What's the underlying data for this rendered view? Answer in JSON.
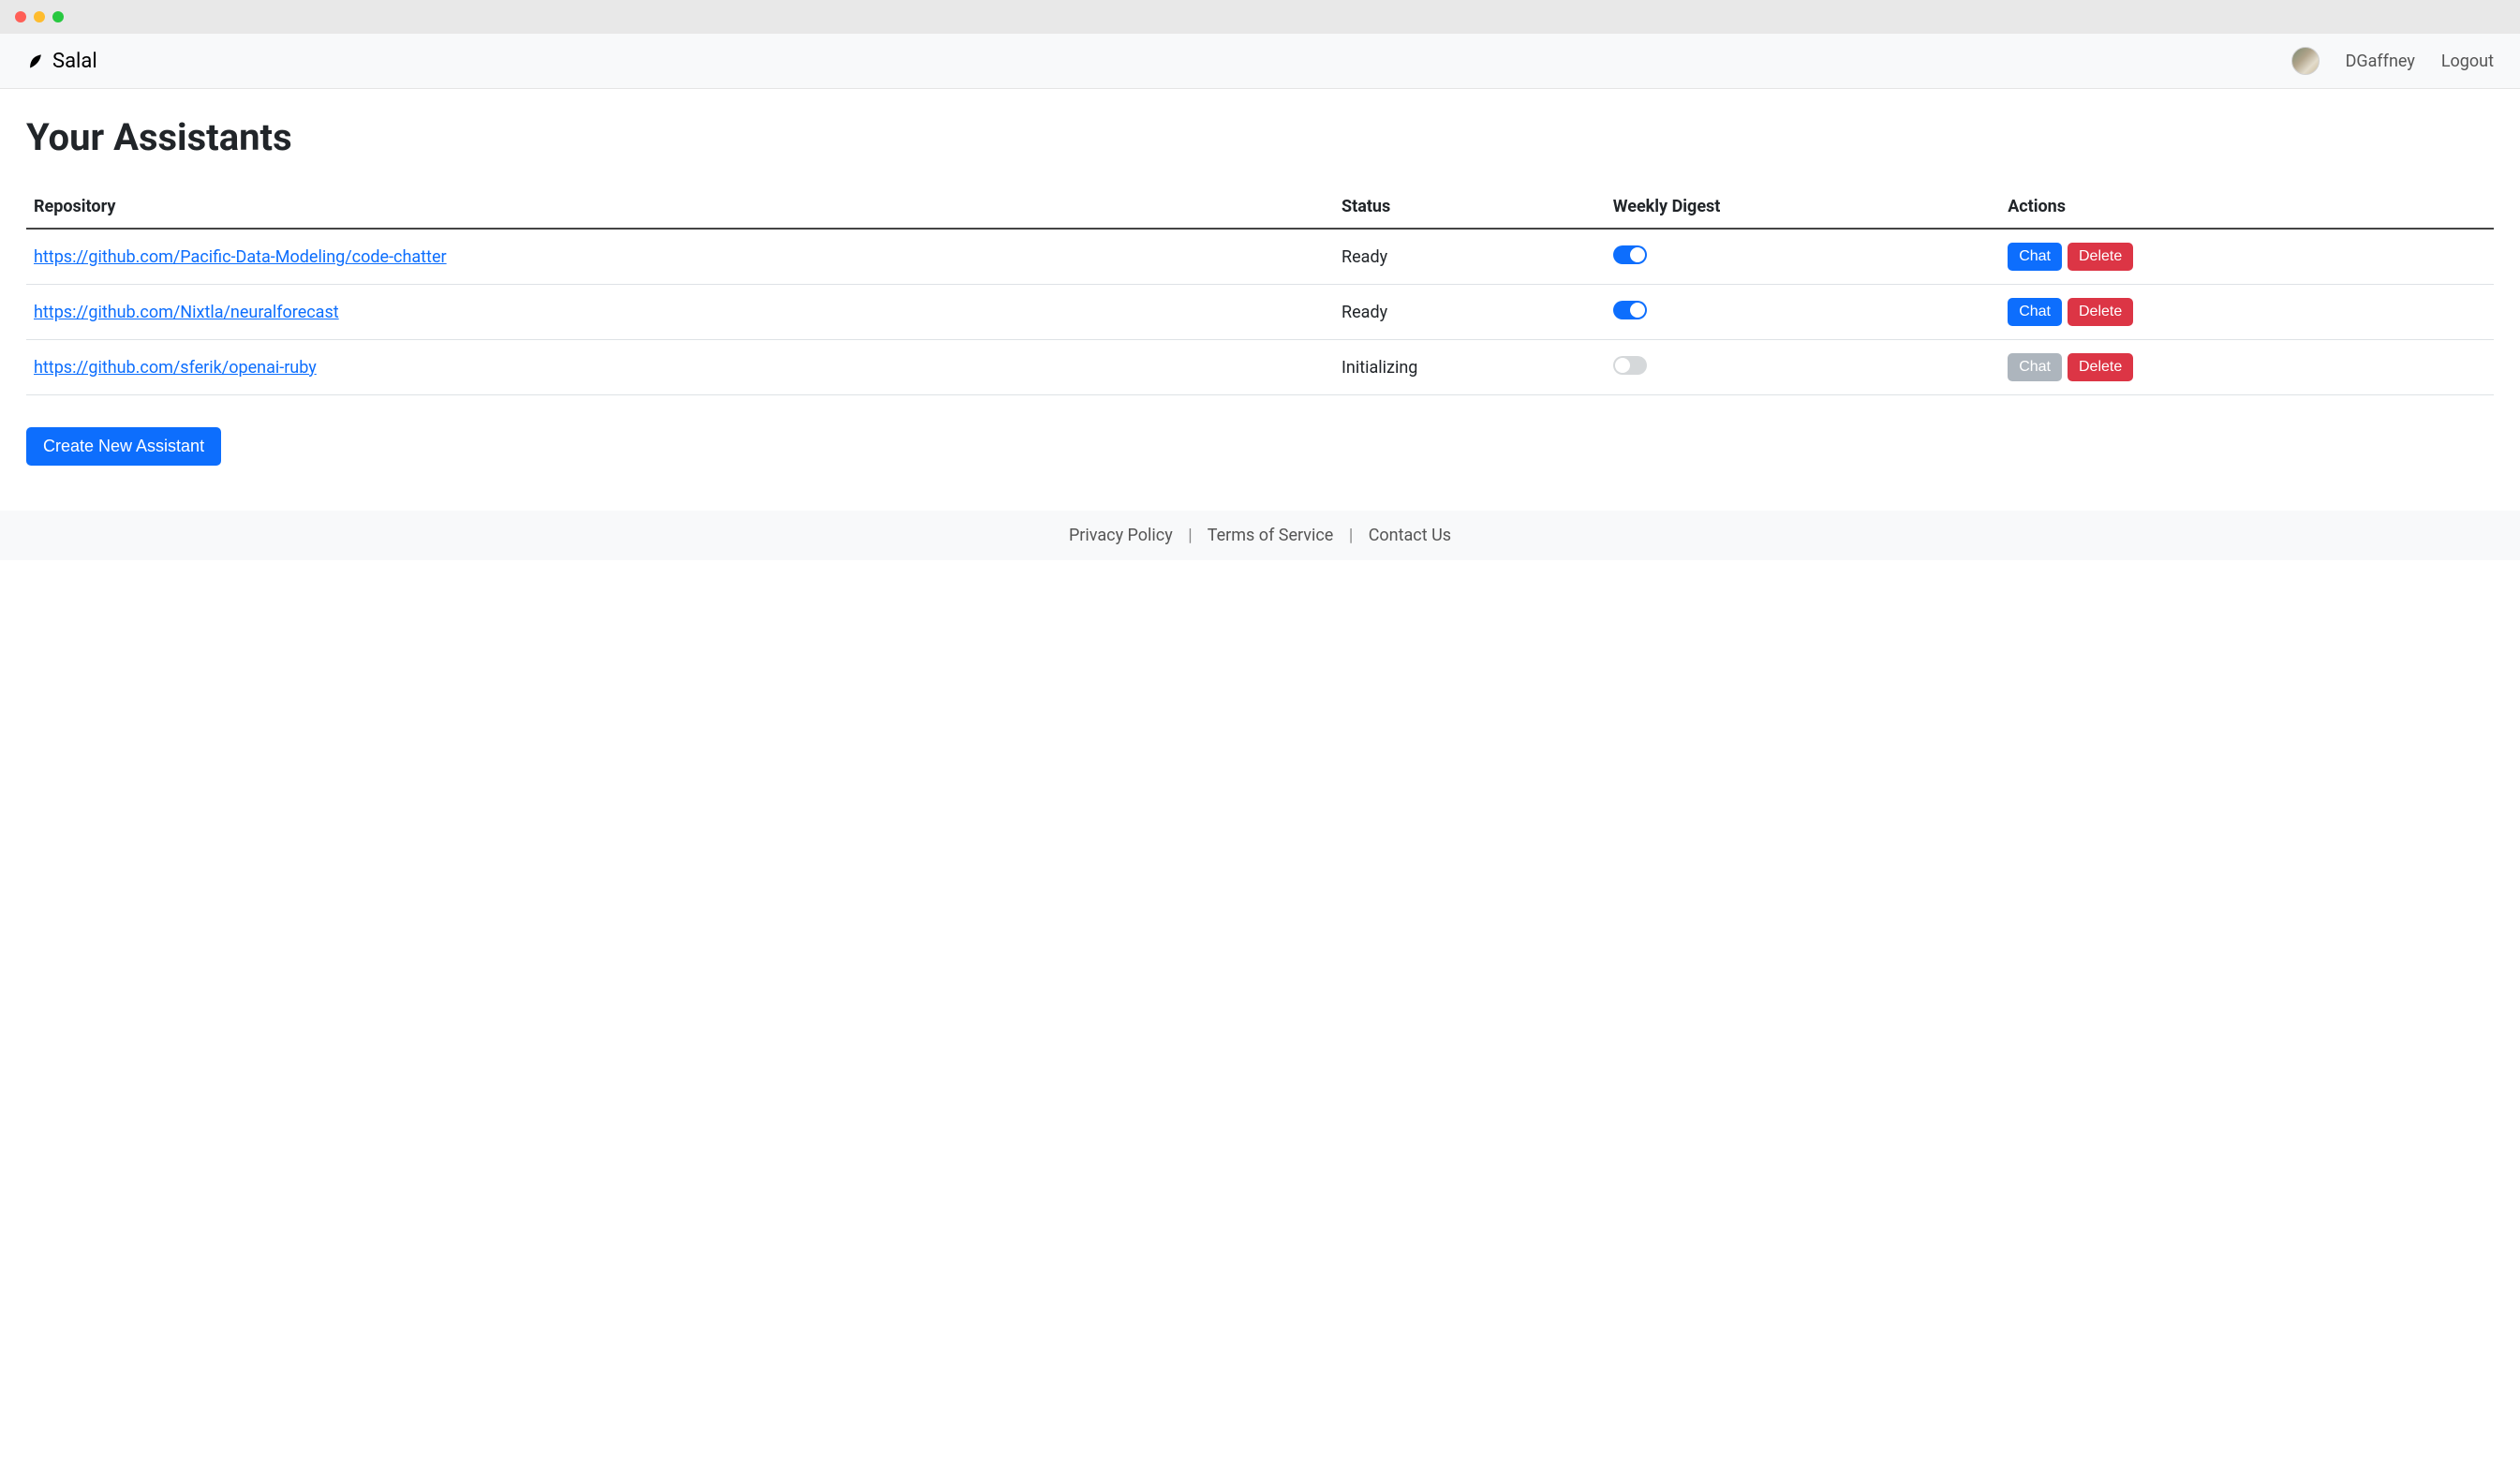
{
  "brand": {
    "name": "Salal"
  },
  "nav": {
    "username": "DGaffney",
    "logout_label": "Logout"
  },
  "page": {
    "title": "Your Assistants",
    "create_button_label": "Create New Assistant",
    "chat_button_label": "Chat",
    "delete_button_label": "Delete"
  },
  "table": {
    "headers": {
      "repository": "Repository",
      "status": "Status",
      "digest": "Weekly Digest",
      "actions": "Actions"
    },
    "rows": [
      {
        "repository": "https://github.com/Pacific-Data-Modeling/code-chatter",
        "status": "Ready",
        "digest_on": true,
        "chat_enabled": true
      },
      {
        "repository": "https://github.com/Nixtla/neuralforecast",
        "status": "Ready",
        "digest_on": true,
        "chat_enabled": true
      },
      {
        "repository": "https://github.com/sferik/openai-ruby",
        "status": "Initializing",
        "digest_on": false,
        "chat_enabled": false
      }
    ]
  },
  "footer": {
    "privacy": "Privacy Policy",
    "terms": "Terms of Service",
    "contact": "Contact Us",
    "sep": "|"
  }
}
